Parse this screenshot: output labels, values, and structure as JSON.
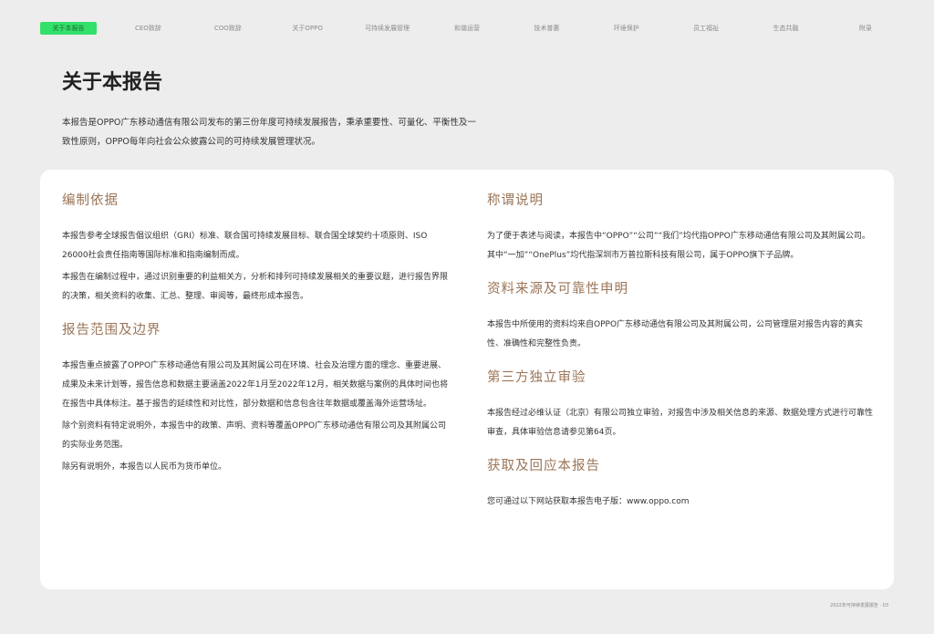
{
  "nav": [
    "关于本报告",
    "CEO致辞",
    "COO致辞",
    "关于OPPO",
    "可持续发展管理",
    "和谐运营",
    "技术普惠",
    "环境保护",
    "员工福祉",
    "生态共融",
    "附录"
  ],
  "title": "关于本报告",
  "intro": "本报告是OPPO广东移动通信有限公司发布的第三份年度可持续发展报告，秉承重要性、可量化、平衡性及一致性原则，OPPO每年向社会公众披露公司的可持续发展管理状况。",
  "left": [
    {
      "heading": "编制依据",
      "paras": [
        "本报告参考全球报告倡议组织（GRI）标准、联合国可持续发展目标、联合国全球契约十项原则、ISO 26000社会责任指南等国际标准和指南编制而成。",
        "本报告在编制过程中，通过识别重要的利益相关方，分析和排列可持续发展相关的重要议题，进行报告界限的决策，相关资料的收集、汇总、整理、审阅等，最终形成本报告。"
      ]
    },
    {
      "heading": "报告范围及边界",
      "paras": [
        "本报告重点披露了OPPO广东移动通信有限公司及其附属公司在环境、社会及治理方面的理念、重要进展、成果及未来计划等，报告信息和数据主要涵盖2022年1月至2022年12月，相关数据与案例的具体时间也将在报告中具体标注。基于报告的延续性和对比性，部分数据和信息包含往年数据或覆盖海外运营场址。",
        "除个别资料有特定说明外，本报告中的政策、声明、资料等覆盖OPPO广东移动通信有限公司及其附属公司的实际业务范围。",
        "除另有说明外，本报告以人民币为货币单位。"
      ]
    }
  ],
  "right": [
    {
      "heading": "称谓说明",
      "paras": [
        "为了便于表述与阅读，本报告中“OPPO”“公司”“我们”均代指OPPO广东移动通信有限公司及其附属公司。其中“一加”“OnePlus”均代指深圳市万普拉斯科技有限公司，属于OPPO旗下子品牌。"
      ]
    },
    {
      "heading": "资料来源及可靠性申明",
      "paras": [
        "本报告中所使用的资料均来自OPPO广东移动通信有限公司及其附属公司，公司管理层对报告内容的真实性、准确性和完整性负责。"
      ]
    },
    {
      "heading": "第三方独立审验",
      "paras": [
        "本报告经过必维认证（北京）有限公司独立审验，对报告中涉及相关信息的来源、数据处理方式进行可靠性审查，具体审验信息请参见第64页。"
      ]
    },
    {
      "heading": "获取及回应本报告",
      "paras": [
        "您可通过以下网站获取本报告电子版：www.oppo.com"
      ]
    }
  ],
  "footer": "2022年可持续发展报告 · 03"
}
